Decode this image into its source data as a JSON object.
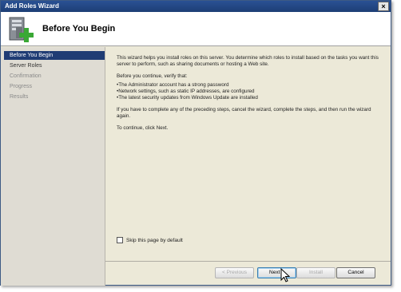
{
  "window": {
    "title": "Add Roles Wizard",
    "close_glyph": "×"
  },
  "header": {
    "heading": "Before You Begin",
    "icon": "server-add-icon"
  },
  "sidebar": {
    "items": [
      {
        "label": "Before You Begin",
        "state": "active"
      },
      {
        "label": "Server Roles",
        "state": "normal"
      },
      {
        "label": "Confirmation",
        "state": "disabled"
      },
      {
        "label": "Progress",
        "state": "disabled"
      },
      {
        "label": "Results",
        "state": "disabled"
      }
    ]
  },
  "content": {
    "intro": "This wizard helps you install roles on this server. You determine which roles to install based on the tasks you want this server to perform, such as sharing documents or hosting a Web site.",
    "verify_heading": "Before you continue, verify that:",
    "checks": [
      "The Administrator account has a strong password",
      "Network settings, such as static IP addresses, are configured",
      "The latest security updates from Windows Update are installed"
    ],
    "advice": "If you have to complete any of the preceding steps, cancel the wizard, complete the steps, and then run the wizard again.",
    "continue": "To continue, click Next.",
    "skip_label": "Skip this page by default"
  },
  "buttons": {
    "previous": "< Previous",
    "next": "Next >",
    "install": "Install",
    "cancel": "Cancel"
  },
  "colors": {
    "title_bar": "#1d3e75",
    "active_nav": "#1f3c74",
    "sidebar": "#dfdcd3",
    "install_plus": "#3aa835"
  }
}
